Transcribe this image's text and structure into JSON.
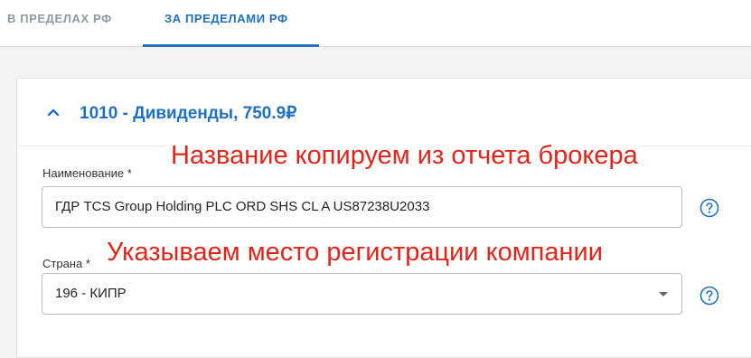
{
  "tabs": {
    "inside_label": "В ПРЕДЕЛАХ РФ",
    "outside_label": "ЗА ПРЕДЕЛАМИ РФ",
    "active": "outside"
  },
  "card": {
    "title": "1010 - Дивиденды, 750.9₽",
    "expanded": true,
    "collapse_icon": "chevron-up-icon"
  },
  "form": {
    "name_label": "Наименование *",
    "name_value": "ГДР TCS Group Holding PLC ORD SHS CL A US87238U2033",
    "country_label": "Страна *",
    "country_value": "196 - КИПР",
    "help_icon": "question-circle-icon"
  },
  "annotations": {
    "name_note": "Название копируем из отчета брокера",
    "country_note": "Указываем место регистрации компании"
  },
  "colors": {
    "accent": "#1f6fc3",
    "inactive_tab": "#8e98a5",
    "annotation": "#e0251b"
  }
}
